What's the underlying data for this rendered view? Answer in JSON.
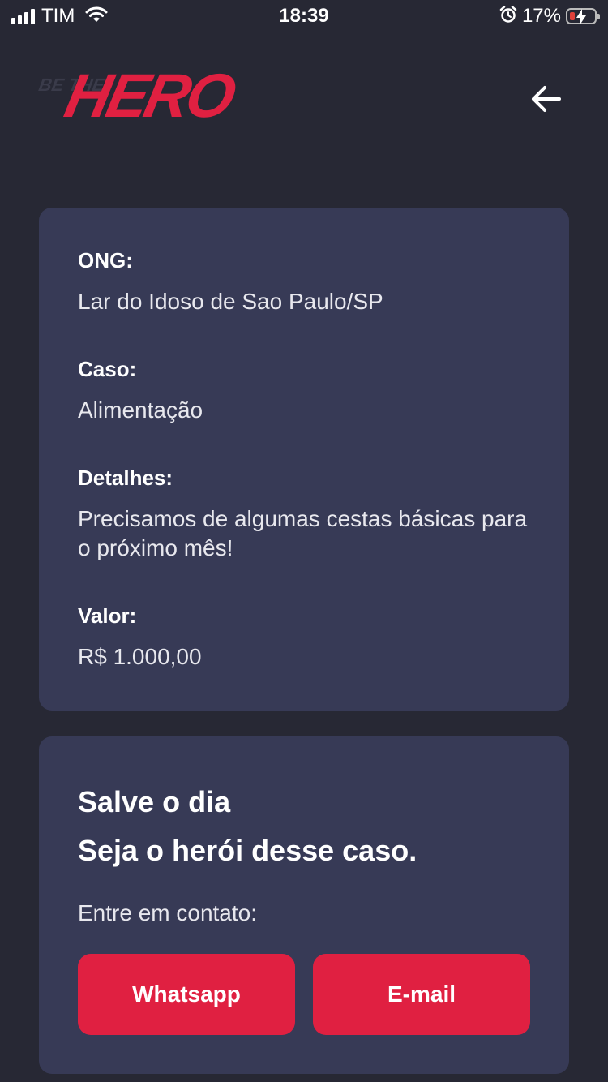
{
  "status_bar": {
    "carrier": "TIM",
    "time": "18:39",
    "battery_percent": "17%",
    "battery_level": 0.17,
    "icons": [
      "signal-icon",
      "wifi-icon",
      "alarm-icon",
      "battery-charging-icon"
    ]
  },
  "header": {
    "logo_small": "BE THE",
    "logo_main": "HERO",
    "back_icon": "arrow-left-icon"
  },
  "incident": {
    "ong_label": "ONG:",
    "ong_value": "Lar do Idoso de Sao Paulo/SP",
    "case_label": "Caso:",
    "case_value": "Alimentação",
    "details_label": "Detalhes:",
    "details_value": "Precisamos de algumas cestas básicas para o próximo mês!",
    "value_label": "Valor:",
    "value_value": "R$ 1.000,00"
  },
  "contact": {
    "title_line1": "Salve o dia",
    "title_line2": "Seja o herói desse caso.",
    "description": "Entre em contato:",
    "whatsapp_label": "Whatsapp",
    "email_label": "E-mail"
  },
  "colors": {
    "background": "#272834",
    "card": "#373a56",
    "accent": "#e02041"
  }
}
